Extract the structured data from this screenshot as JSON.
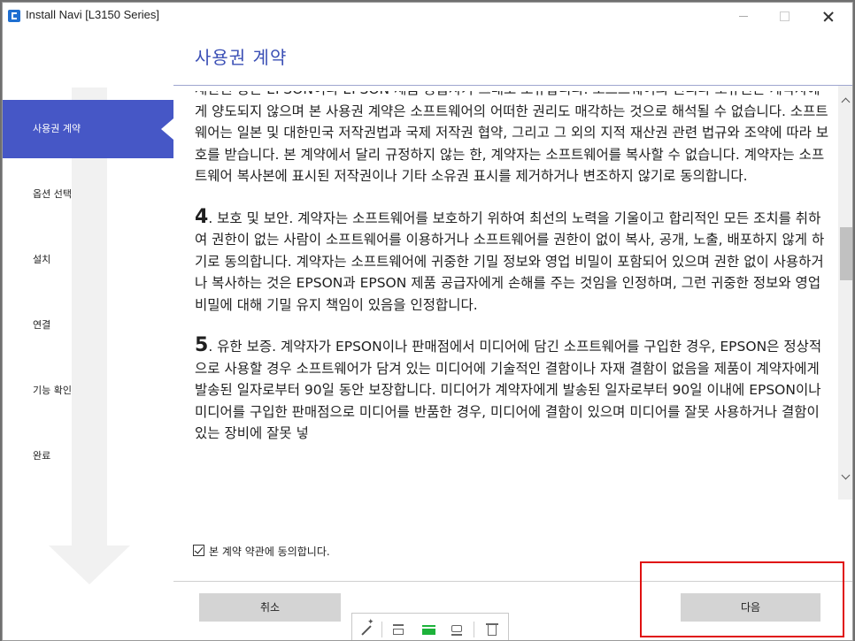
{
  "window": {
    "title": "Install Navi [L3150 Series]"
  },
  "sidebar": {
    "steps": [
      {
        "label": "사용권 계약",
        "active": true
      },
      {
        "label": "옵션 선택",
        "active": false
      },
      {
        "label": "설치",
        "active": false
      },
      {
        "label": "연결",
        "active": false
      },
      {
        "label": "기능 확인",
        "active": false
      },
      {
        "label": "완료",
        "active": false
      }
    ]
  },
  "main": {
    "title": "사용권 계약",
    "license_paragraphs": [
      {
        "number": "",
        "text": "재산권 등은 EPSON이나 EPSON 제품 공급자가 그대로 보유합니다. 소프트웨어의 권리나 소유권은 계약자에게 양도되지 않으며 본 사용권 계약은 소프트웨어의 어떠한 권리도 매각하는 것으로 해석될 수 없습니다. 소프트웨어는 일본 및 대한민국 저작권법과 국제 저작권 협약, 그리고 그 외의 지적 재산권 관련 법규와 조약에 따라 보호를 받습니다. 본 계약에서 달리 규정하지 않는 한, 계약자는 소프트웨어를 복사할 수 없습니다. 계약자는 소프트웨어 복사본에 표시된 저작권이나 기타 소유권 표시를 제거하거나 변조하지 않기로 동의합니다."
      },
      {
        "number": "4",
        "text": ". 보호 및 보안. 계약자는 소프트웨어를 보호하기 위하여 최선의 노력을 기울이고 합리적인 모든 조치를 취하여 권한이 없는 사람이 소프트웨어를 이용하거나 소프트웨어를 권한이 없이 복사, 공개, 노출, 배포하지 않게 하기로 동의합니다. 계약자는 소프트웨어에 귀중한 기밀 정보와 영업 비밀이 포함되어 있으며 권한 없이 사용하거나 복사하는 것은 EPSON과 EPSON 제품 공급자에게 손해를 주는 것임을 인정하며, 그런 귀중한 정보와 영업 비밀에 대해 기밀 유지 책임이 있음을 인정합니다."
      },
      {
        "number": "5",
        "text": ". 유한 보증. 계약자가 EPSON이나 판매점에서 미디어에 담긴 소프트웨어를 구입한 경우, EPSON은 정상적으로 사용할 경우 소프트웨어가 담겨 있는 미디어에 기술적인 결함이나 자재 결함이 없음을 제품이 계약자에게 발송된 일자로부터 90일 동안 보장합니다. 미디어가 계약자에게 발송된 일자로부터 90일 이내에 EPSON이나 미디어를 구입한 판매점으로 미디어를 반품한 경우, 미디어에 결함이 있으며 미디어를 잘못 사용하거나 결함이 있는 장비에 잘못 넣"
      }
    ],
    "agree_checkbox": {
      "label": "본 계약 약관에 동의합니다.",
      "checked": true
    }
  },
  "footer": {
    "cancel_label": "취소",
    "next_label": "다음"
  },
  "mini_toolbar": {
    "icons": [
      "magic-wand-icon",
      "align-left-icon",
      "align-center-icon",
      "align-right-icon",
      "trash-icon"
    ],
    "active_color": "#1db23a"
  },
  "colors": {
    "accent": "#4657c6",
    "title": "#3b4fb5",
    "highlight": "#e01010"
  }
}
